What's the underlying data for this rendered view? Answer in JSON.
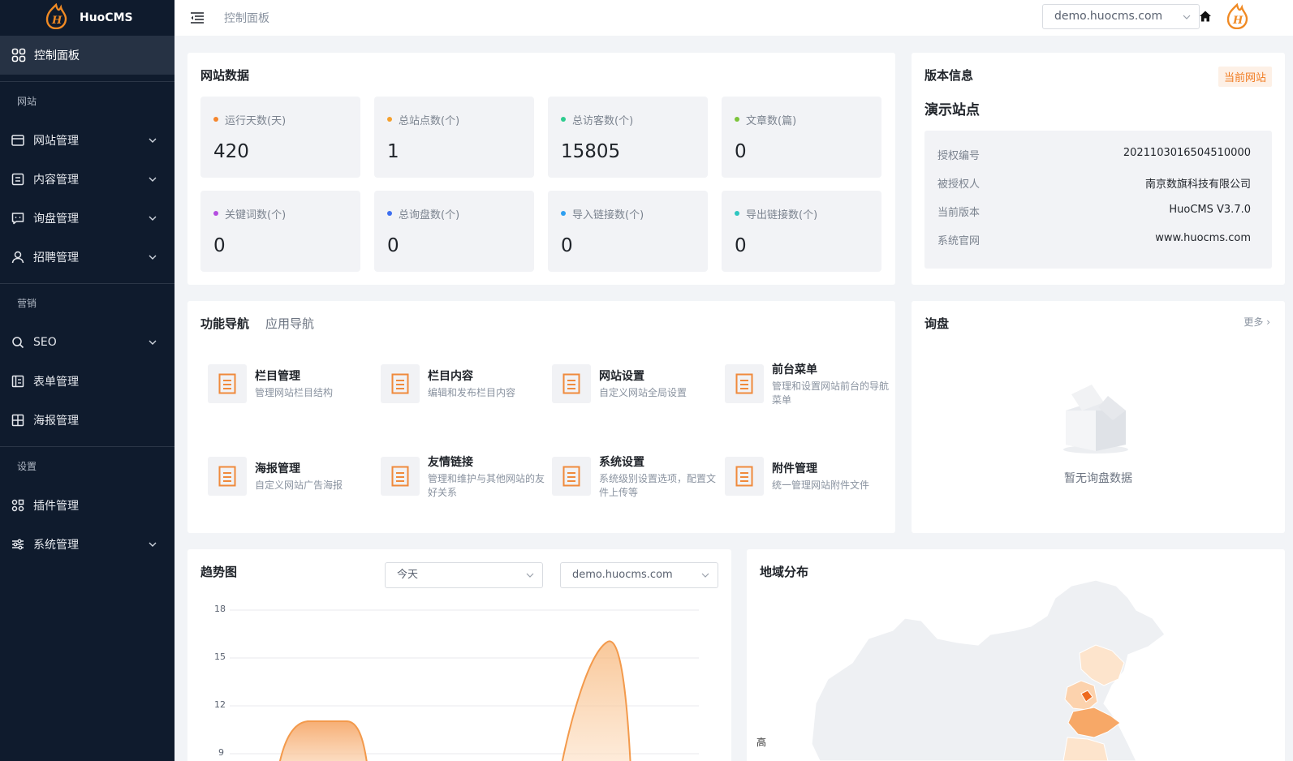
{
  "brand": {
    "name": "HuoCMS"
  },
  "sidebar": {
    "active": "控制面板",
    "groups": [
      {
        "title": "网站",
        "items": [
          {
            "label": "网站管理",
            "icon": "browser-icon"
          },
          {
            "label": "内容管理",
            "icon": "document-icon"
          },
          {
            "label": "询盘管理",
            "icon": "message-icon"
          },
          {
            "label": "招聘管理",
            "icon": "user-icon"
          }
        ]
      },
      {
        "title": "营销",
        "items": [
          {
            "label": "SEO",
            "icon": "search-icon"
          },
          {
            "label": "表单管理",
            "icon": "form-icon"
          },
          {
            "label": "海报管理",
            "icon": "grid-icon"
          }
        ]
      },
      {
        "title": "设置",
        "items": [
          {
            "label": "插件管理",
            "icon": "plugin-icon"
          },
          {
            "label": "系统管理",
            "icon": "sliders-icon"
          }
        ]
      }
    ]
  },
  "topbar": {
    "breadcrumb": "控制面板",
    "site": "demo.huocms.com"
  },
  "stats": {
    "title": "网站数据",
    "items": [
      {
        "label": "运行天数(天)",
        "value": "420",
        "color": "#f5862d"
      },
      {
        "label": "总站点数(个)",
        "value": "1",
        "color": "#f5a02d"
      },
      {
        "label": "总访客数(个)",
        "value": "15805",
        "color": "#2ecc8f"
      },
      {
        "label": "文章数(篇)",
        "value": "0",
        "color": "#7cc43a"
      },
      {
        "label": "关键词数(个)",
        "value": "0",
        "color": "#b44de0"
      },
      {
        "label": "总询盘数(个)",
        "value": "0",
        "color": "#3d6ff0"
      },
      {
        "label": "导入链接数(个)",
        "value": "0",
        "color": "#2e9ff0"
      },
      {
        "label": "导出链接数(个)",
        "value": "0",
        "color": "#2ec6c0"
      }
    ]
  },
  "version": {
    "title": "版本信息",
    "tag": "当前网站",
    "site_name": "演示站点",
    "rows": [
      {
        "key": "授权编号",
        "value": "2021103016504510000"
      },
      {
        "key": "被授权人",
        "value": "南京数旗科技有限公司"
      },
      {
        "key": "当前版本",
        "value": "HuoCMS V3.7.0"
      },
      {
        "key": "系统官网",
        "value": "www.huocms.com"
      }
    ]
  },
  "nav": {
    "tabs": [
      "功能导航",
      "应用导航"
    ],
    "items": [
      {
        "title": "栏目管理",
        "desc": "管理网站栏目结构"
      },
      {
        "title": "栏目内容",
        "desc": "编辑和发布栏目内容"
      },
      {
        "title": "网站设置",
        "desc": "自定义网站全局设置"
      },
      {
        "title": "前台菜单",
        "desc": "管理和设置网站前台的导航菜单"
      },
      {
        "title": "海报管理",
        "desc": "自定义网站广告海报"
      },
      {
        "title": "友情链接",
        "desc": "管理和维护与其他网站的友好关系"
      },
      {
        "title": "系统设置",
        "desc": "系统级别设置选项，配置文件上传等"
      },
      {
        "title": "附件管理",
        "desc": "统一管理网站附件文件"
      }
    ]
  },
  "inquiry": {
    "title": "询盘",
    "more": "更多",
    "empty": "暂无询盘数据"
  },
  "trend": {
    "title": "趋势图",
    "period": "今天",
    "site": "demo.huocms.com"
  },
  "chart_data": {
    "type": "area",
    "title": "趋势图",
    "yticks": [
      18,
      15,
      12,
      9
    ],
    "ylim": [
      9,
      18
    ],
    "grid": true,
    "series": [
      {
        "values": [
          11,
          16
        ]
      }
    ]
  },
  "region": {
    "title": "地域分布",
    "legend_high": "高"
  },
  "colors": {
    "accent": "#f07c22",
    "sidebar": "#0f1b2d"
  }
}
